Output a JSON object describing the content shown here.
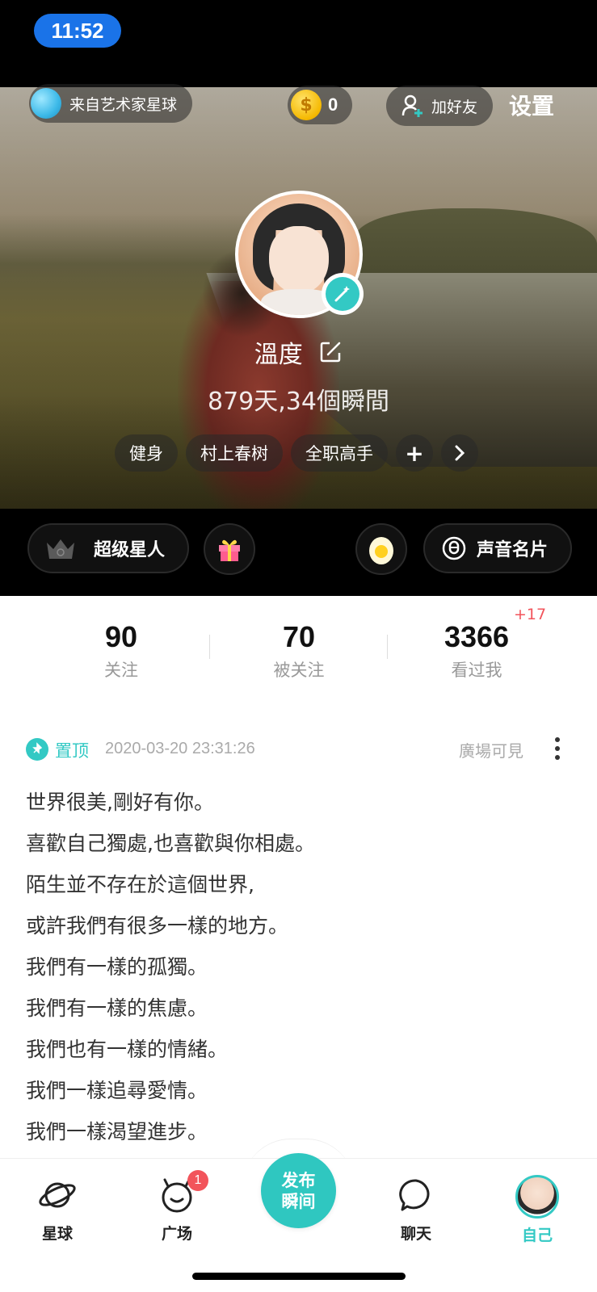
{
  "status_bar": {
    "time": "11:52"
  },
  "header": {
    "planet_label": "来自艺术家星球",
    "coins": "0",
    "add_friend_label": "加好友",
    "settings_label": "设置"
  },
  "profile": {
    "nickname": "溫度",
    "summary": "879天,34個瞬間",
    "tags": [
      "健身",
      "村上春树",
      "全职高手"
    ],
    "add_tag_symbol": "+",
    "more_tags_symbol": "›"
  },
  "toolbar": {
    "super_star_label": "超级星人",
    "voice_card_label": "声音名片"
  },
  "stats": {
    "following": {
      "value": "90",
      "label": "关注"
    },
    "followers": {
      "value": "70",
      "label": "被关注"
    },
    "visitors": {
      "value": "3366",
      "label": "看过我",
      "increment": "+17"
    }
  },
  "post": {
    "pin_label": "置顶",
    "timestamp": "2020-03-20 23:31:26",
    "visibility": "廣場可見",
    "lines": [
      "世界很美,剛好有你。",
      "喜歡自己獨處,也喜歡與你相處。",
      "陌生並不存在於這個世界,",
      "或許我們有很多一樣的地方。",
      "我們有一樣的孤獨。",
      "我們有一樣的焦慮。",
      "我們也有一樣的情緒。",
      "我們一樣追尋愛情。",
      "我們一樣渴望進步。"
    ]
  },
  "tabbar": {
    "planet": "星球",
    "square": "广场",
    "square_badge": "1",
    "publish_line1": "发布",
    "publish_line2": "瞬间",
    "chat": "聊天",
    "me": "自己"
  },
  "colors": {
    "accent": "#33c9c4",
    "badge": "#f2545b",
    "time_pill": "#1a73e8"
  }
}
